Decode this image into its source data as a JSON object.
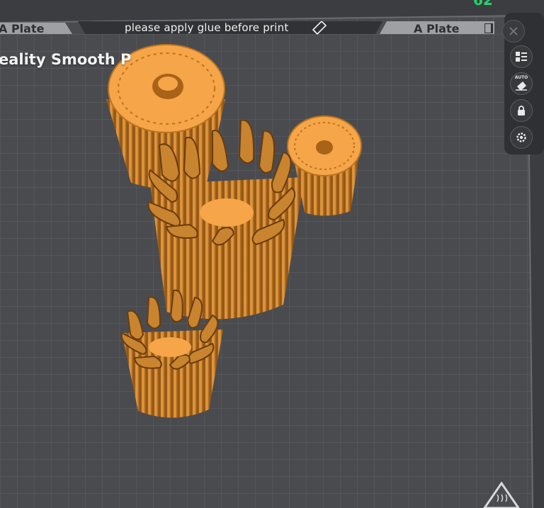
{
  "plate": {
    "left_tab_label": "A Plate",
    "right_tab_label": "A Plate",
    "glue_notice": "please apply glue before print",
    "material_label": "eality Smooth P"
  },
  "top_indicator": "62",
  "toolbar": {
    "close_icon": "close-icon",
    "layout_icon": "arrange-icon",
    "auto_label": "AUTO",
    "auto_icon": "auto-orient-icon",
    "lock_icon": "lock-icon",
    "settings_icon": "gear-icon"
  },
  "colors": {
    "bed": "#4a4b4f",
    "grid": "#5b5c61",
    "model": "#e99a3b",
    "model_light": "#fdb55a",
    "model_dark": "#9c5d16",
    "panel": "#2e2f33"
  }
}
